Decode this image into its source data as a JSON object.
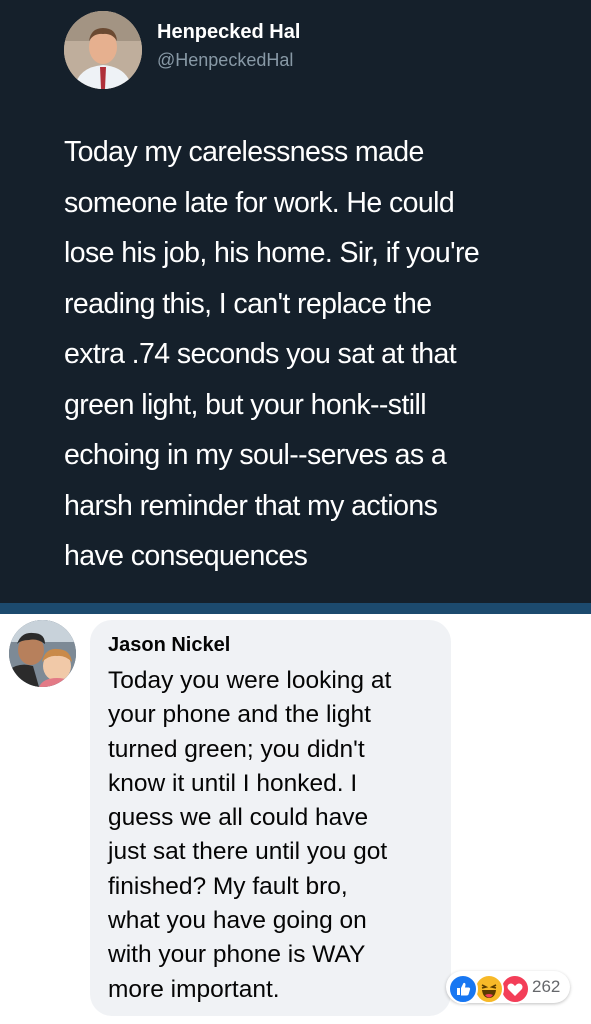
{
  "tweet": {
    "display_name": "Henpecked Hal",
    "handle": "@HenpeckedHal",
    "lines": [
      "Today my carelessness made",
      "someone late for work. He could",
      "lose his job, his home. Sir, if you're",
      "reading this, I can't replace the",
      "extra .74 seconds you sat at that",
      "green light, but your honk--still",
      "echoing in my soul--serves as a",
      "harsh reminder that my actions",
      "have consequences"
    ]
  },
  "comment": {
    "author": "Jason Nickel",
    "lines": [
      "Today you were looking at",
      "your phone and the light",
      "turned green; you didn't",
      "know it until I honked. I",
      "guess we all could have",
      "just sat there until you got",
      "finished? My fault bro,",
      "what you have going on",
      "with your phone is WAY",
      "more important."
    ],
    "reactions": {
      "icons": [
        "like-icon",
        "haha-icon",
        "love-icon"
      ],
      "count": "262"
    }
  },
  "colors": {
    "tweet_bg": "#15202b",
    "tweet_divider": "#1c4a6e",
    "handle": "#8899a6",
    "bubble_bg": "#f0f2f5",
    "like": "#1877f2",
    "haha": "#f7b928",
    "love": "#f33e58"
  }
}
